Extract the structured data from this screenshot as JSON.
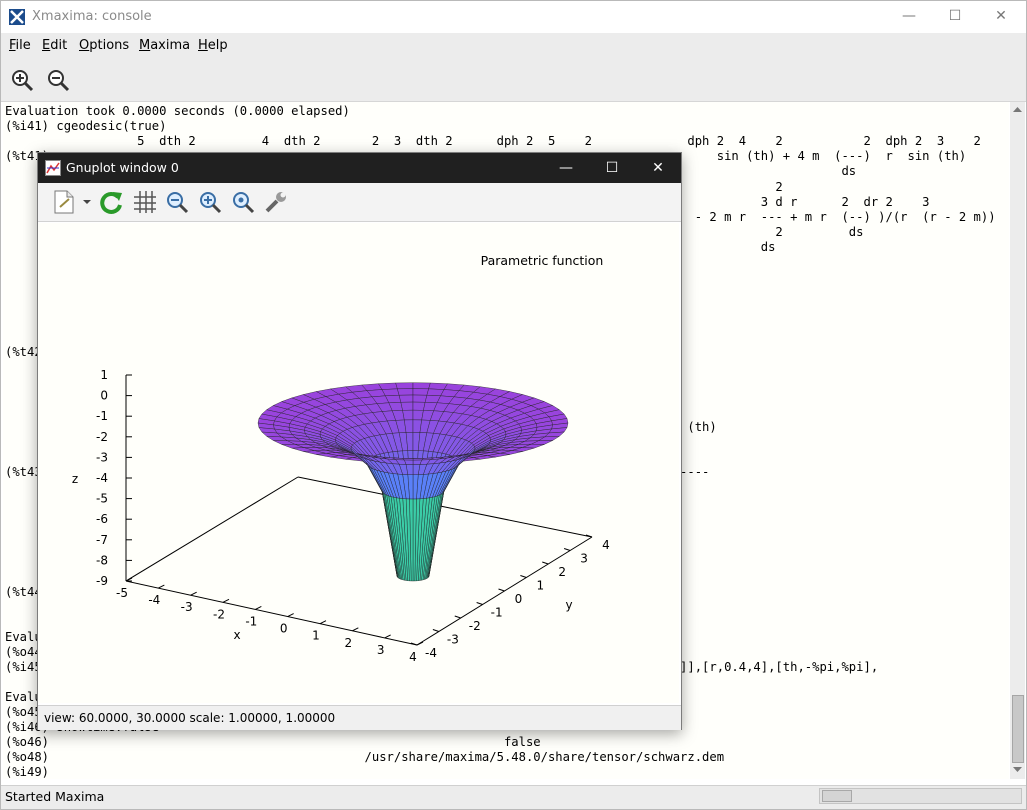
{
  "window": {
    "title": "Xmaxima: console"
  },
  "menu": [
    {
      "key": "F",
      "rest": "ile"
    },
    {
      "key": "E",
      "rest": "dit"
    },
    {
      "key": "O",
      "rest": "ptions"
    },
    {
      "key": "M",
      "rest": "axima"
    },
    {
      "key": "H",
      "rest": "elp"
    }
  ],
  "console_lines": [
    {
      "t": "Evaluation took 0.0000 seconds (0.0000 elapsed)"
    },
    {
      "t": "(%i41) cgeodesic(true)"
    },
    {
      "t": "                  5  dth 2         4  dth 2       2  3  dth 2      dph 2  5    2             dph 2  4    2           2  dph 2  3    2"
    },
    {
      "t": "(%t41)"
    },
    {
      "t": "                                                                                                 sin (th) + 4 m  (---)  r  sin (th)"
    },
    {
      "t": "                                                                                                                  ds"
    },
    {
      "t": "                                                                                                         2"
    },
    {
      "t": "                                                                                                       3 d r      2  dr 2    3"
    },
    {
      "t": "                                                                                              - 2 m r  --- + m r  (--) )/(r  (r - 2 m))"
    },
    {
      "t": "                                                                                                         2         ds"
    },
    {
      "t": "                                                                                                       ds"
    },
    {
      "t": "(%t42)"
    },
    {
      "t": "                                                                                             (th)"
    },
    {
      "t": "(%t43)"
    },
    {
      "t": "                                                                                            ----"
    },
    {
      "t": "(%t44)"
    },
    {
      "t": "Evalu"
    },
    {
      "t": "(%o44)"
    },
    {
      "t": "(%i45)"
    },
    {
      "t": "                                                                                           1]],[r,0.4,4],[th,-%pi,%pi],"
    },
    {
      "t": "Evalu"
    },
    {
      "t": "(%o45)"
    },
    {
      "t": "(%i46) showtime:false"
    },
    {
      "t": "(%o46)                                                              false"
    },
    {
      "t": "(%o48)                                           /usr/share/maxima/5.48.0/share/tensor/schwarz.dem"
    },
    {
      "t": "(%i49)"
    }
  ],
  "status": {
    "text": "Started Maxima"
  },
  "gnuplot": {
    "title": "Gnuplot window 0",
    "status": "view:  60.0000,  30.0000   scale:  1.00000,  1.00000",
    "plot_title": "Parametric function",
    "zlabel": "z",
    "xlabel": "x",
    "ylabel": "y",
    "zticks": [
      "1",
      "0",
      "-1",
      "-2",
      "-3",
      "-4",
      "-5",
      "-6",
      "-7",
      "-8",
      "-9"
    ],
    "xticks": [
      "-5",
      "-4",
      "-3",
      "-2",
      "-1",
      "0",
      "1",
      "2",
      "3",
      "4"
    ],
    "yticks": [
      "-4",
      "-3",
      "-2",
      "-1",
      "0",
      "1",
      "2",
      "3",
      "4"
    ],
    "colors": {
      "top": "#9944dd",
      "mid": "#4a8fff",
      "bottom": "#33ee77"
    }
  }
}
